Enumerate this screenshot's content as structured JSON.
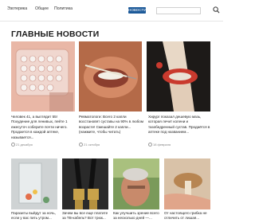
{
  "nav": {
    "items": [
      "Эзотерика",
      "Общее",
      "Политика"
    ],
    "news_button": "НОВОСТИ"
  },
  "heading": "ГЛАВНЫЕ НОВОСТИ",
  "cards": [
    {
      "title": "Человек 41, а выглядит 55! Похудение для ленивых, пейте 1 ежесуточ соберите почти ничего. Продается в каждой аптеке, называется...",
      "date": "21 декабря"
    },
    {
      "title": "Ревматологи: Всего 2 капли восстановят суставы на 90% в любом возрасте! Смешайте 2 капли... (нажмите, чтобы читать)",
      "date": "21 октября"
    },
    {
      "title": "Хирург показал дешевую мазь, которая лечит колени и тазобедренный сустав. Продаётся в аптеке под названием...",
      "date": "18 февраля"
    },
    {
      "title": "Паразиты выйдут за ночь, если у вас пить утром...",
      "date": ""
    },
    {
      "title": "Зачем вы все еще платите за ТВ-кабель? Вот трюк...",
      "date": ""
    },
    {
      "title": "Как улучшить зрение всего за несколько дней —...",
      "date": ""
    },
    {
      "title": "От настоящего грибка не отличить от лишая...",
      "date": ""
    }
  ]
}
